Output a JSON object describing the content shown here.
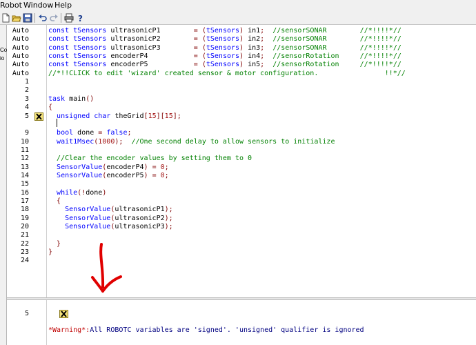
{
  "menu": {
    "items": [
      "Robot",
      "Window",
      "Help"
    ]
  },
  "toolbar": {
    "icons": [
      "new-file-icon",
      "open-file-icon",
      "save-icon",
      "undo-icon",
      "redo-icon",
      "print-icon",
      "help-icon"
    ]
  },
  "left_panel": {
    "fragments": [
      "Co",
      "io"
    ]
  },
  "editor": {
    "lines": [
      {
        "num": "Auto",
        "text": "const tSensors ultrasonicP1        = (tSensors) in1;  //sensorSONAR        //*!!!!*//"
      },
      {
        "num": "Auto",
        "text": "const tSensors ultrasonicP2        = (tSensors) in2;  //sensorSONAR        //*!!!!*//"
      },
      {
        "num": "Auto",
        "text": "const tSensors ultrasonicP3        = (tSensors) in3;  //sensorSONAR        //*!!!!*//"
      },
      {
        "num": "Auto",
        "text": "const tSensors encoderP4           = (tSensors) in4;  //sensorRotation     //*!!!!*//"
      },
      {
        "num": "Auto",
        "text": "const tSensors encoderP5           = (tSensors) in5;  //sensorRotation     //*!!!!*//"
      },
      {
        "num": "Auto",
        "text": "//*!!CLICK to edit 'wizard' created sensor & motor configuration.                !!*//"
      },
      {
        "num": "1",
        "text": ""
      },
      {
        "num": "2",
        "text": ""
      },
      {
        "num": "3",
        "text": "task main()"
      },
      {
        "num": "4",
        "text": "{"
      },
      {
        "num": "5",
        "text": "  unsigned char theGrid[15][15];"
      },
      {
        "num": "",
        "text": ""
      },
      {
        "num": "9",
        "text": "  bool done = false;"
      },
      {
        "num": "10",
        "text": "  wait1Msec(1000);  //One second delay to allow sensors to initialize"
      },
      {
        "num": "11",
        "text": ""
      },
      {
        "num": "12",
        "text": "  //Clear the encoder values by setting them to 0"
      },
      {
        "num": "13",
        "text": "  SensorValue(encoderP4) = 0;"
      },
      {
        "num": "14",
        "text": "  SensorValue(encoderP5) = 0;"
      },
      {
        "num": "15",
        "text": ""
      },
      {
        "num": "16",
        "text": "  while(!done)"
      },
      {
        "num": "17",
        "text": "  {"
      },
      {
        "num": "18",
        "text": "    SensorValue(ultrasonicP1);"
      },
      {
        "num": "19",
        "text": "    SensorValue(ultrasonicP2);"
      },
      {
        "num": "20",
        "text": "    SensorValue(ultrasonicP3);"
      },
      {
        "num": "21",
        "text": ""
      },
      {
        "num": "22",
        "text": "  }"
      },
      {
        "num": "23",
        "text": "}"
      },
      {
        "num": "24",
        "text": ""
      }
    ],
    "warning_marker_line": "5"
  },
  "output": {
    "line_num": "5",
    "tag": "*Warning*:",
    "message": "All ROBOTC variables are 'signed'. 'unsigned' qualifier is ignored"
  },
  "colors": {
    "keyword": "#0000ff",
    "comment": "#008000",
    "warning": "#c00000",
    "annotation_arrow": "#e00000"
  }
}
